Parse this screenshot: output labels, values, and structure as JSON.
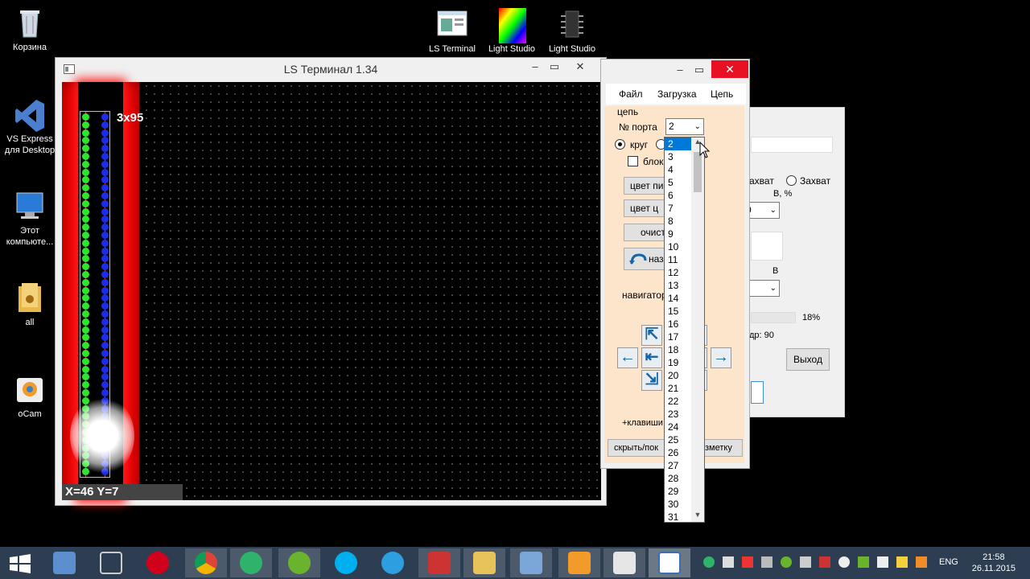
{
  "desktop": {
    "icons": [
      {
        "label": "Корзина"
      },
      {
        "label": "VS Express\nдля Desktop"
      },
      {
        "label": "Этот\nкомпьюте..."
      },
      {
        "label": "all"
      },
      {
        "label": "oCam"
      },
      {
        "label": "LS Terminal"
      },
      {
        "label": "Light Studio"
      },
      {
        "label": "Light Studio"
      }
    ]
  },
  "terminal": {
    "title": "LS Терминал 1.34",
    "size_label": "3x95",
    "coords": "X=46  Y=7"
  },
  "panel": {
    "menu": [
      "Файл",
      "Загрузка",
      "Цепь"
    ],
    "group_label": "цепь",
    "port_label": "№ порта",
    "port_value": "2",
    "radio_circle": "круг",
    "checkbox_block": "блок",
    "btn_color_pix": "цвет пи",
    "btn_color_chain": "цвет ц",
    "btn_clear": "очист",
    "btn_back": "наз",
    "navigator_label": "навигатор",
    "keys_label": "+клавиши",
    "btn_hide_show": "скрыть/пок",
    "btn_markup": "зметку",
    "dropdown_options": [
      "2",
      "3",
      "4",
      "5",
      "6",
      "7",
      "8",
      "9",
      "10",
      "11",
      "12",
      "13",
      "14",
      "15",
      "16",
      "17",
      "18",
      "19",
      "20",
      "21",
      "22",
      "23",
      "24",
      "25",
      "26",
      "27",
      "28",
      "29",
      "30",
      "31"
    ]
  },
  "back_window": {
    "capture1": "ахват",
    "capture2": "Захват",
    "brightness": "В, %",
    "val0": "0",
    "b_label": "В",
    "percent": "18%",
    "frames": "др: 90",
    "exit": "Выход"
  },
  "taskbar": {
    "lang": "ENG",
    "time": "21:58",
    "date": "26.11.2015"
  }
}
